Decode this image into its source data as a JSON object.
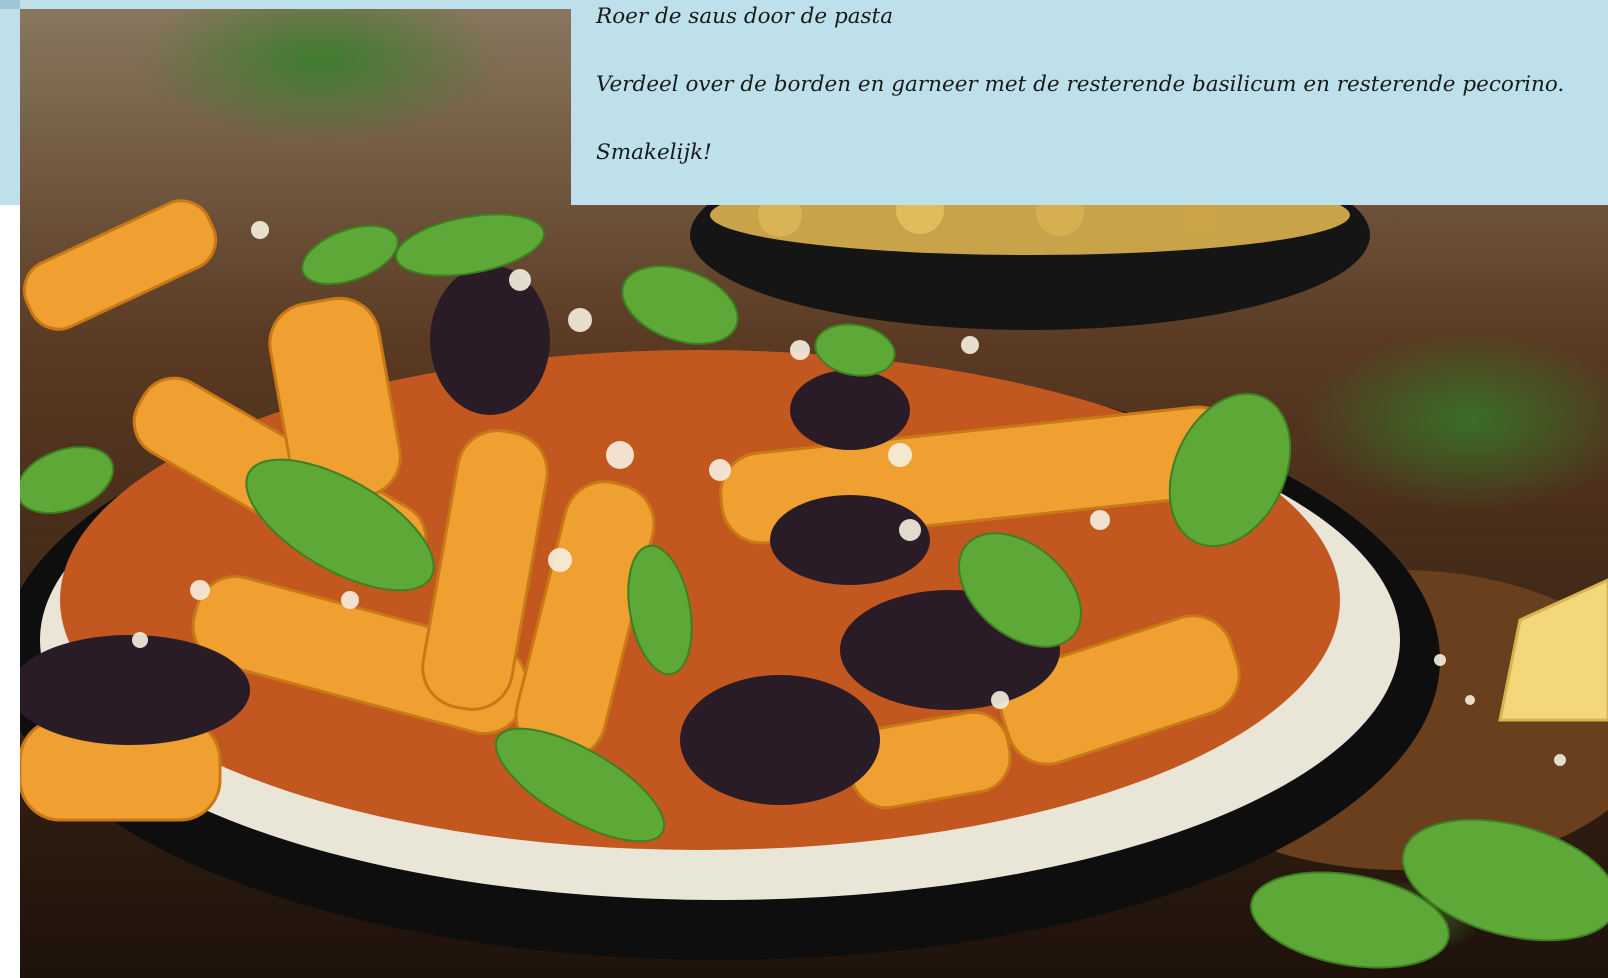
{
  "recipe": {
    "steps": [
      "Roer de saus door de pasta",
      "Verdeel over de borden en garneer met de resterende basilicum en resterende pecorino.",
      "Smakelijk!"
    ]
  },
  "photo": {
    "subject": "pasta-plate-photo"
  },
  "colors": {
    "panel_background": "#bde0ea",
    "text": "#1a1a1a"
  }
}
